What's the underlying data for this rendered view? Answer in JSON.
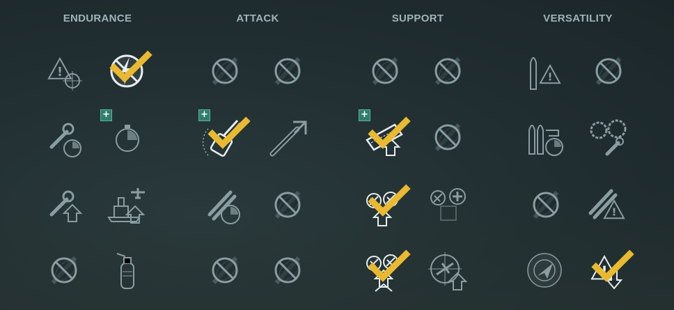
{
  "columns": [
    {
      "id": "endurance",
      "title": "ENDURANCE"
    },
    {
      "id": "attack",
      "title": "ATTACK"
    },
    {
      "id": "support",
      "title": "SUPPORT"
    },
    {
      "id": "versatility",
      "title": "VERSATILITY"
    }
  ],
  "colors": {
    "background": "#223033",
    "title": "#9db4b8",
    "icon_active": "#e8eef0",
    "icon_inactive": "#8a9ea2",
    "check": "#e9b92f",
    "plus_badge": "#2f7f6e"
  },
  "skills": [
    {
      "column": "endurance",
      "row": 1,
      "slot": 1,
      "icon": "warning-target-icon",
      "state": "available",
      "selected": false,
      "plus": false
    },
    {
      "column": "endurance",
      "row": 1,
      "slot": 2,
      "icon": "lightning-disabled-icon",
      "state": "active",
      "selected": true,
      "plus": false
    },
    {
      "column": "endurance",
      "row": 2,
      "slot": 1,
      "icon": "wrench-timer-icon",
      "state": "available",
      "selected": false,
      "plus": false
    },
    {
      "column": "endurance",
      "row": 2,
      "slot": 2,
      "icon": "stopwatch-icon",
      "state": "available",
      "selected": false,
      "plus": true
    },
    {
      "column": "endurance",
      "row": 3,
      "slot": 1,
      "icon": "wrench-up-icon",
      "state": "available",
      "selected": false,
      "plus": false
    },
    {
      "column": "endurance",
      "row": 3,
      "slot": 2,
      "icon": "ship-aircraft-up-icon",
      "state": "available",
      "selected": false,
      "plus": false
    },
    {
      "column": "endurance",
      "row": 4,
      "slot": 1,
      "icon": "locked-icon",
      "state": "locked",
      "selected": false,
      "plus": false
    },
    {
      "column": "endurance",
      "row": 4,
      "slot": 2,
      "icon": "extinguisher-icon",
      "state": "available",
      "selected": false,
      "plus": false
    },
    {
      "column": "attack",
      "row": 1,
      "slot": 1,
      "icon": "locked-icon",
      "state": "locked",
      "selected": false,
      "plus": false
    },
    {
      "column": "attack",
      "row": 1,
      "slot": 2,
      "icon": "locked-icon",
      "state": "locked",
      "selected": false,
      "plus": false
    },
    {
      "column": "attack",
      "row": 2,
      "slot": 1,
      "icon": "gun-turret-icon",
      "state": "active",
      "selected": true,
      "plus": true
    },
    {
      "column": "attack",
      "row": 2,
      "slot": 2,
      "icon": "torpedo-arrow-icon",
      "state": "available",
      "selected": false,
      "plus": false
    },
    {
      "column": "attack",
      "row": 3,
      "slot": 1,
      "icon": "torpedo-timer-icon",
      "state": "available",
      "selected": false,
      "plus": false
    },
    {
      "column": "attack",
      "row": 3,
      "slot": 2,
      "icon": "locked-icon",
      "state": "locked",
      "selected": false,
      "plus": false
    },
    {
      "column": "attack",
      "row": 4,
      "slot": 1,
      "icon": "locked-icon",
      "state": "locked",
      "selected": false,
      "plus": false
    },
    {
      "column": "attack",
      "row": 4,
      "slot": 2,
      "icon": "locked-icon",
      "state": "locked",
      "selected": false,
      "plus": false
    },
    {
      "column": "support",
      "row": 1,
      "slot": 1,
      "icon": "locked-icon",
      "state": "locked",
      "selected": false,
      "plus": false
    },
    {
      "column": "support",
      "row": 1,
      "slot": 2,
      "icon": "locked-icon",
      "state": "locked",
      "selected": false,
      "plus": false
    },
    {
      "column": "support",
      "row": 2,
      "slot": 1,
      "icon": "armor-up-icon",
      "state": "active",
      "selected": true,
      "plus": true
    },
    {
      "column": "support",
      "row": 2,
      "slot": 2,
      "icon": "locked-icon",
      "state": "locked",
      "selected": false,
      "plus": false
    },
    {
      "column": "support",
      "row": 3,
      "slot": 1,
      "icon": "aa-guns-up-icon",
      "state": "active",
      "selected": true,
      "plus": false
    },
    {
      "column": "support",
      "row": 3,
      "slot": 2,
      "icon": "aa-plus-icon",
      "state": "available",
      "selected": false,
      "plus": false
    },
    {
      "column": "support",
      "row": 4,
      "slot": 1,
      "icon": "aa-double-up-icon",
      "state": "active",
      "selected": true,
      "plus": false
    },
    {
      "column": "support",
      "row": 4,
      "slot": 2,
      "icon": "crosshair-plane-up-icon",
      "state": "available",
      "selected": false,
      "plus": false
    },
    {
      "column": "versatility",
      "row": 1,
      "slot": 1,
      "icon": "shell-warning-icon",
      "state": "available",
      "selected": false,
      "plus": false
    },
    {
      "column": "versatility",
      "row": 1,
      "slot": 2,
      "icon": "locked-icon",
      "state": "locked",
      "selected": false,
      "plus": false
    },
    {
      "column": "versatility",
      "row": 2,
      "slot": 1,
      "icon": "shells-timer-icon",
      "state": "available",
      "selected": false,
      "plus": false
    },
    {
      "column": "versatility",
      "row": 2,
      "slot": 2,
      "icon": "gears-wrench-icon",
      "state": "available",
      "selected": false,
      "plus": false
    },
    {
      "column": "versatility",
      "row": 3,
      "slot": 1,
      "icon": "locked-icon",
      "state": "locked",
      "selected": false,
      "plus": false
    },
    {
      "column": "versatility",
      "row": 3,
      "slot": 2,
      "icon": "torpedo-warning-icon",
      "state": "available",
      "selected": false,
      "plus": false
    },
    {
      "column": "versatility",
      "row": 4,
      "slot": 1,
      "icon": "radar-icon",
      "state": "available",
      "selected": false,
      "plus": false
    },
    {
      "column": "versatility",
      "row": 4,
      "slot": 2,
      "icon": "warning-down-icon",
      "state": "active",
      "selected": true,
      "plus": false
    }
  ]
}
